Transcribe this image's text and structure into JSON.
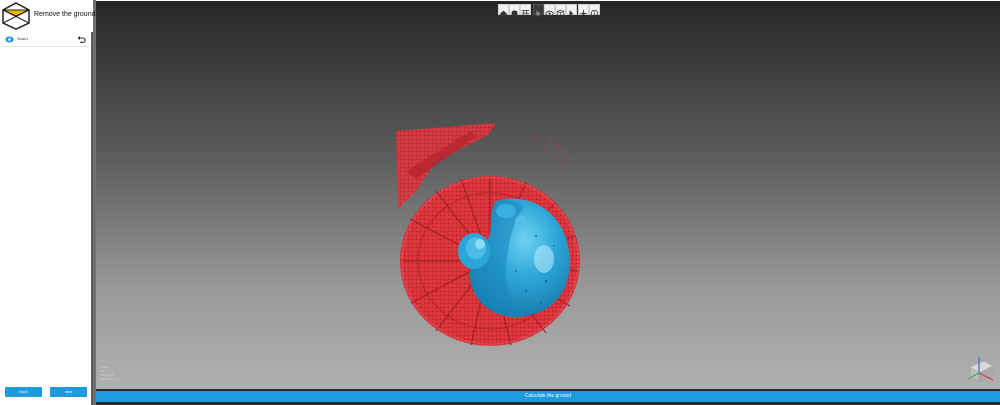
{
  "header": {
    "title": "Remove the ground"
  },
  "layers": [
    {
      "label": "Scan1"
    }
  ],
  "footer": {
    "back_label": "back",
    "next_label": "next"
  },
  "viewport": {
    "info_lines": [
      "vertex",
      "0.5",
      "0.5 gmm2",
      "face: 112 0.1m"
    ]
  },
  "calculate_label": "Calculate the ground",
  "colors": {
    "accent": "#1e9be0",
    "ground_points": "#d9323a",
    "object_points": "#1f97c9"
  },
  "toolbar_icons": [
    "home-icon",
    "front-view-icon",
    "grid-icon",
    "cursor-icon",
    "eye-icon",
    "wireframe-icon",
    "select-icon",
    "transform-icon",
    "info-icon"
  ]
}
